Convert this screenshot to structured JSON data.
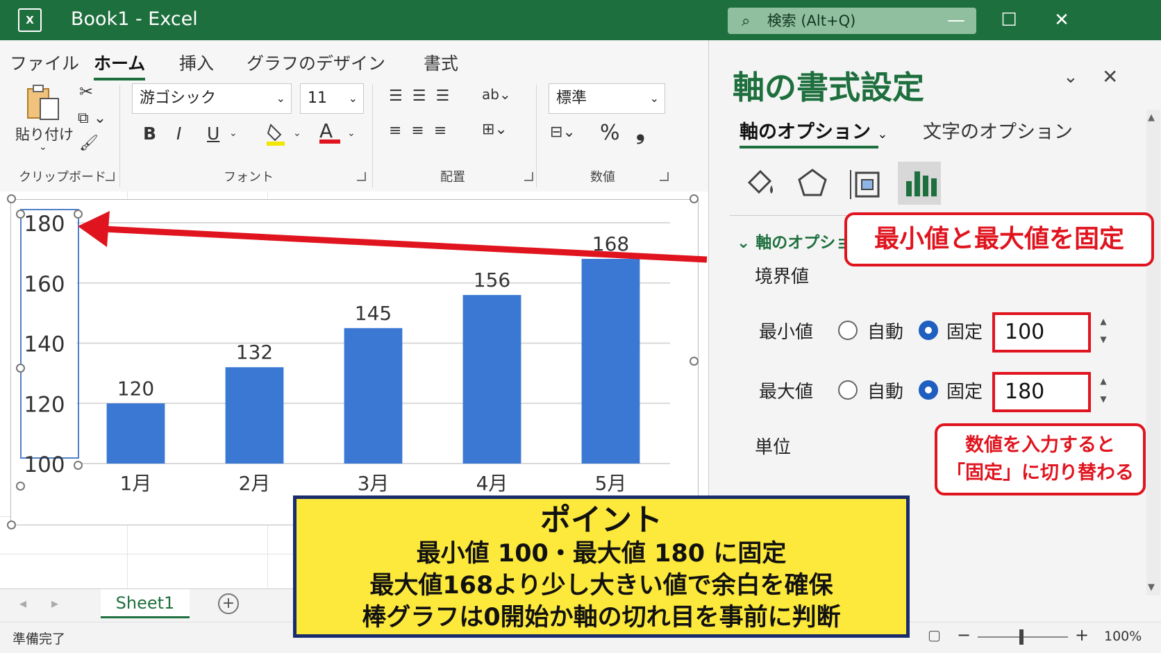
{
  "window": {
    "title": "Book1 - Excel",
    "app_icon": "excel-icon",
    "search_placeholder": "検索 (Alt+Q)",
    "controls": [
      "minimize-icon",
      "maximize-icon",
      "close-icon"
    ]
  },
  "ribbon": {
    "tabs": [
      {
        "label": "ファイル",
        "active": false
      },
      {
        "label": "ホーム",
        "active": true
      },
      {
        "label": "挿入",
        "active": false
      },
      {
        "label": "グラフのデザイン",
        "active": false
      },
      {
        "label": "書式",
        "active": false
      }
    ],
    "clipboard": {
      "paste_label": "貼り付け",
      "group_label": "クリップボード"
    },
    "font": {
      "name": "游ゴシック",
      "size": "11",
      "bold": "B",
      "italic": "I",
      "underline": "U",
      "font_color_glyph": "A",
      "group_label": "フォント"
    },
    "alignment": {
      "group_label": "配置"
    },
    "number": {
      "format": "標準",
      "percent": "%",
      "comma": "❟",
      "group_label": "数値"
    },
    "colors": {
      "accent": "#1e6f3e",
      "highlight_underline": "#f2e500",
      "font_color_underline": "#e0141e"
    }
  },
  "chart_data": {
    "type": "bar",
    "categories": [
      "1月",
      "2月",
      "3月",
      "4月",
      "5月"
    ],
    "values": [
      120,
      132,
      145,
      156,
      168
    ],
    "ylim": [
      100,
      180
    ],
    "yticks": [
      100,
      120,
      140,
      160,
      180
    ],
    "grid": true,
    "bar_color": "#3a78d4",
    "data_labels": true
  },
  "sheet_tabs": {
    "active": "Sheet1",
    "add_icon": "plus-circle-icon"
  },
  "status": {
    "ready": "準備完了",
    "zoom": "100%"
  },
  "pane": {
    "title": "軸の書式設定",
    "tab_axis_options": "軸のオプション",
    "tab_text_options": "文字のオプション",
    "icons": [
      "fill-bucket-icon",
      "pentagon-icon",
      "size-properties-icon",
      "bar-chart-icon"
    ],
    "section_title": "軸のオプション",
    "bounds_label": "境界値",
    "min": {
      "label": "最小値",
      "auto_label": "自動",
      "fixed_label": "固定",
      "value": "100",
      "mode": "fixed"
    },
    "max": {
      "label": "最大値",
      "auto_label": "自動",
      "fixed_label": "固定",
      "value": "180",
      "mode": "fixed"
    },
    "units_label": "単位"
  },
  "callouts": {
    "fix_title": "最小値と最大値を固定",
    "input_note_line1": "数値を入力すると",
    "input_note_line2": "「固定」に切り替わる"
  },
  "point_box": {
    "heading": "ポイント",
    "lines": [
      "最小値 100・最大値 180 に固定",
      "最大値168より少し大きい値で余白を確保",
      "棒グラフは0開始か軸の切れ目を事前に判断"
    ]
  }
}
